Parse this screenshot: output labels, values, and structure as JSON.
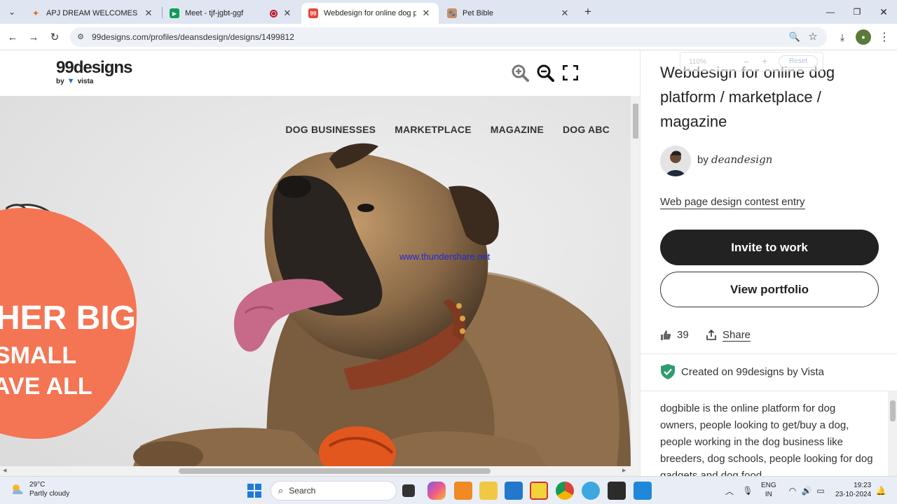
{
  "browser": {
    "tabs": [
      {
        "title": "APJ DREAM WELCOMES",
        "icon": "rocket-favicon-icon"
      },
      {
        "title": "Meet - tjf-jgbt-ggf",
        "icon": "google-meet-favicon-icon"
      },
      {
        "title": "Webdesign for online dog platf",
        "icon": "99designs-favicon-icon"
      },
      {
        "title": "Pet Bible",
        "icon": "pet-bible-favicon-icon"
      }
    ],
    "active_tab_index": 2,
    "url": "99designs.com/profiles/deansdesign/designs/1499812"
  },
  "viewer": {
    "logo_main": "99designs",
    "logo_by": "by",
    "logo_brand": "vista",
    "zoom_popover": {
      "level": "110%",
      "minus": "−",
      "plus": "+",
      "reset": "Reset"
    }
  },
  "design_preview": {
    "nav": [
      "DOG BUSINESSES",
      "MARKETPLACE",
      "MAGAZINE",
      "DOG ABC"
    ],
    "hero_lines": [
      "HER BIG",
      "SMALL",
      "AVE ALL"
    ],
    "watermark": "www.thundershare.net"
  },
  "sidebar": {
    "title": "Webdesign for online dog platform / marketplace / magazine",
    "by_label": "by",
    "author": "deandesign",
    "contest_link": "Web page design contest entry",
    "invite_button": "Invite to work",
    "portfolio_button": "View portfolio",
    "likes": "39",
    "share_label": "Share",
    "created_text": "Created on 99designs by Vista",
    "description": "dogbible is the online platform for dog owners, people looking to get/buy a dog, people working in the dog business like breeders, dog schools, people looking for dog gadgets and dog food"
  },
  "taskbar": {
    "temperature": "29°C",
    "weather": "Partly cloudy",
    "search_placeholder": "Search",
    "lang_top": "ENG",
    "lang_bottom": "IN",
    "time": "19:23",
    "date": "23-10-2024"
  },
  "colors": {
    "accent_orange": "#f37554",
    "button_dark": "#222222",
    "shield_green": "#2e9d6d",
    "tab_strip": "#dfe6f2"
  }
}
